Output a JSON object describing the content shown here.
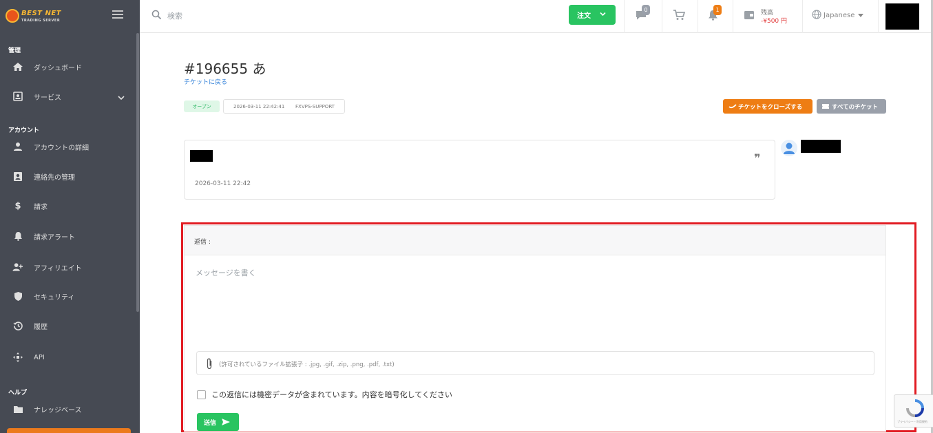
{
  "brand": {
    "name": "BEST NET",
    "tagline": "TRADING SERVER"
  },
  "sidebar": {
    "sections": [
      {
        "title": "管理"
      },
      {
        "title": "アカウント"
      },
      {
        "title": "ヘルプ"
      }
    ],
    "items": [
      {
        "label": "ダッシュボード",
        "icon": "home-icon"
      },
      {
        "label": "サービス",
        "icon": "service-icon"
      },
      {
        "label": "アカウントの詳細",
        "icon": "user-icon"
      },
      {
        "label": "連絡先の管理",
        "icon": "contacts-icon"
      },
      {
        "label": "請求",
        "icon": "dollar-icon"
      },
      {
        "label": "請求アラート",
        "icon": "bell-icon"
      },
      {
        "label": "アフィリエイト",
        "icon": "affiliate-icon"
      },
      {
        "label": "セキュリティ",
        "icon": "shield-icon"
      },
      {
        "label": "履歴",
        "icon": "history-icon"
      },
      {
        "label": "API",
        "icon": "api-icon"
      },
      {
        "label": "ナレッジベース",
        "icon": "folder-icon"
      }
    ]
  },
  "topbar": {
    "search_placeholder": "検索",
    "order_label": "注文",
    "messages_count": "0",
    "notifications_count": "1",
    "balance_label": "残高",
    "balance_value": "-¥500 円",
    "language": "Japanese"
  },
  "ticket": {
    "title": "#196655 あ",
    "back_link": "チケットに戻る",
    "status": "オープン",
    "created": "2026-03-11 22:42:41",
    "department": "FXVPS-SUPPORT",
    "close_label": "チケットをクローズする",
    "all_label": "すべてのチケット"
  },
  "message": {
    "date": "2026-03-11 22:42",
    "quote_icon": "quote-icon"
  },
  "reply": {
    "header": "返信 :",
    "placeholder": "メッセージを書く",
    "attach_hint": "(許可されているファイル拡張子 : .jpg, .gif, .zip, .png, .pdf, .txt)",
    "encrypt_label": "この返信には機密データが含まれています。内容を暗号化してください",
    "send_label": "送信"
  },
  "recaptcha": {
    "text": "プライバシー・利用規約"
  },
  "colors": {
    "sidebar_bg": "#464a53",
    "accent_green": "#29c461",
    "accent_orange": "#ee7d14",
    "highlight_red": "#e11b22",
    "link_blue": "#2f7fd8"
  }
}
